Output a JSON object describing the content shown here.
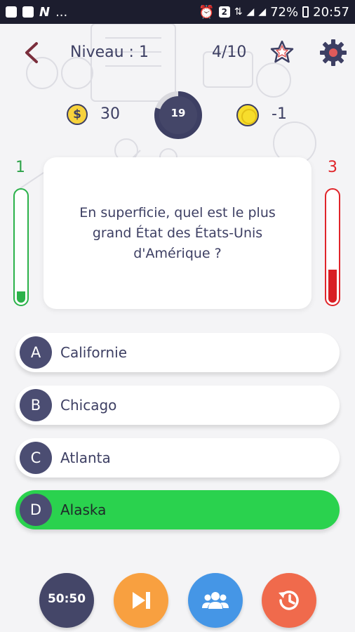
{
  "statusbar": {
    "ellipsis": "...",
    "notif_count": "2",
    "battery": "72%",
    "time": "20:57"
  },
  "header": {
    "level": "Niveau : 1",
    "progress": "4/10"
  },
  "stats": {
    "dollars": "30",
    "timer": "19",
    "timer_fraction": 0.8,
    "gold": "-1"
  },
  "scores": {
    "correct": "1",
    "wrong": "3",
    "correct_fraction": 0.1,
    "wrong_fraction": 0.3
  },
  "question": {
    "text": "En superficie, quel est le plus grand État des États-Unis d'Amérique ?"
  },
  "answers": [
    {
      "letter": "A",
      "text": "Californie"
    },
    {
      "letter": "B",
      "text": "Chicago"
    },
    {
      "letter": "C",
      "text": "Atlanta"
    },
    {
      "letter": "D",
      "text": "Alaska"
    }
  ],
  "lifelines": {
    "fifty": "50:50"
  },
  "colors": {
    "primary": "#3d3f63",
    "correct": "#2ad24e",
    "wrong": "#e0252a",
    "skip": "#f8a040",
    "audience": "#4596e6",
    "rewind": "#f06a4c"
  }
}
